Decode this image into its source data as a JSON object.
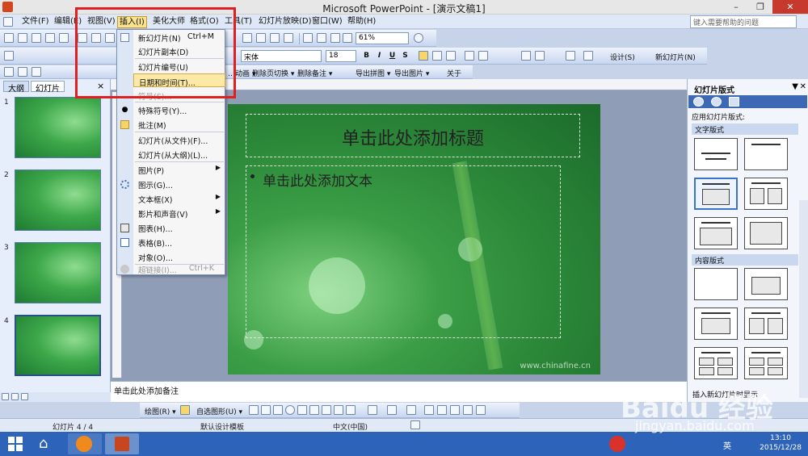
{
  "window": {
    "title": "Microsoft PowerPoint - [演示文稿1]",
    "min": "–",
    "restore": "❐",
    "close": "✕"
  },
  "menubar": {
    "items": [
      "文件(F)",
      "编辑(E)",
      "视图(V)",
      "插入(I)",
      "美化大师",
      "格式(O)",
      "工具(T)",
      "幻灯片放映(D)",
      "窗口(W)",
      "帮助(H)"
    ],
    "help_placeholder": "键入需要帮助的问题"
  },
  "toolbar": {
    "zoom": "61%",
    "font": "宋体",
    "size": "18",
    "bold": "B",
    "italic": "I",
    "underline": "U",
    "shadow": "S",
    "design": "设计(S)",
    "new_slide": "新幻灯片(N)",
    "row3": [
      "…动画 ▾",
      "删除页切换 ▾",
      "删除备注 ▾",
      "导出拼图 ▾",
      "导出图片 ▾",
      "关于"
    ]
  },
  "leftpane": {
    "tabs": [
      "大纲",
      "幻灯片"
    ],
    "close": "×",
    "thumbs": [
      "1",
      "2",
      "3",
      "4"
    ]
  },
  "slide": {
    "title": "单击此处添加标题",
    "body": "单击此处添加文本",
    "watermark": "www.chinafine.cn"
  },
  "notes": "单击此处添加备注",
  "taskpane": {
    "title": "幻灯片版式",
    "apply": "应用幻灯片版式:",
    "text_layouts": "文字版式",
    "content_layouts": "内容版式",
    "footer_checkbox": "插入新幻灯片时显示"
  },
  "drawbar": {
    "draw": "绘图(R) ▾",
    "autoshape": "自选图形(U) ▾"
  },
  "status": {
    "slide": "幻灯片 4 / 4",
    "template": "默认设计模板",
    "lang": "中文(中国)"
  },
  "taskbar": {
    "ime": "英",
    "time": "13:10",
    "date": "2015/12/28"
  },
  "insert_menu": {
    "items": [
      {
        "label": "新幻灯片(N)",
        "shortcut": "Ctrl+M"
      },
      {
        "label": "幻灯片副本(D)"
      },
      {
        "label": "幻灯片编号(U)"
      },
      {
        "label": "日期和时间(T)..."
      },
      {
        "label": "符号(S)..."
      },
      {
        "label": "特殊符号(Y)..."
      },
      {
        "label": "批注(M)"
      },
      {
        "label": "幻灯片(从文件)(F)..."
      },
      {
        "label": "幻灯片(从大纲)(L)..."
      },
      {
        "label": "图片(P)"
      },
      {
        "label": "图示(G)..."
      },
      {
        "label": "文本框(X)"
      },
      {
        "label": "影片和声音(V)"
      },
      {
        "label": "图表(H)..."
      },
      {
        "label": "表格(B)..."
      },
      {
        "label": "对象(O)..."
      },
      {
        "label": "超链接(I)...",
        "shortcut": "Ctrl+K"
      }
    ]
  },
  "watermark": {
    "brand": "Baidu 经验",
    "url": "jingyan.baidu.com"
  },
  "colors": {
    "highlight": "#e02020",
    "menu_hover": "#fde9a6",
    "taskbar": "#2d63b8"
  }
}
